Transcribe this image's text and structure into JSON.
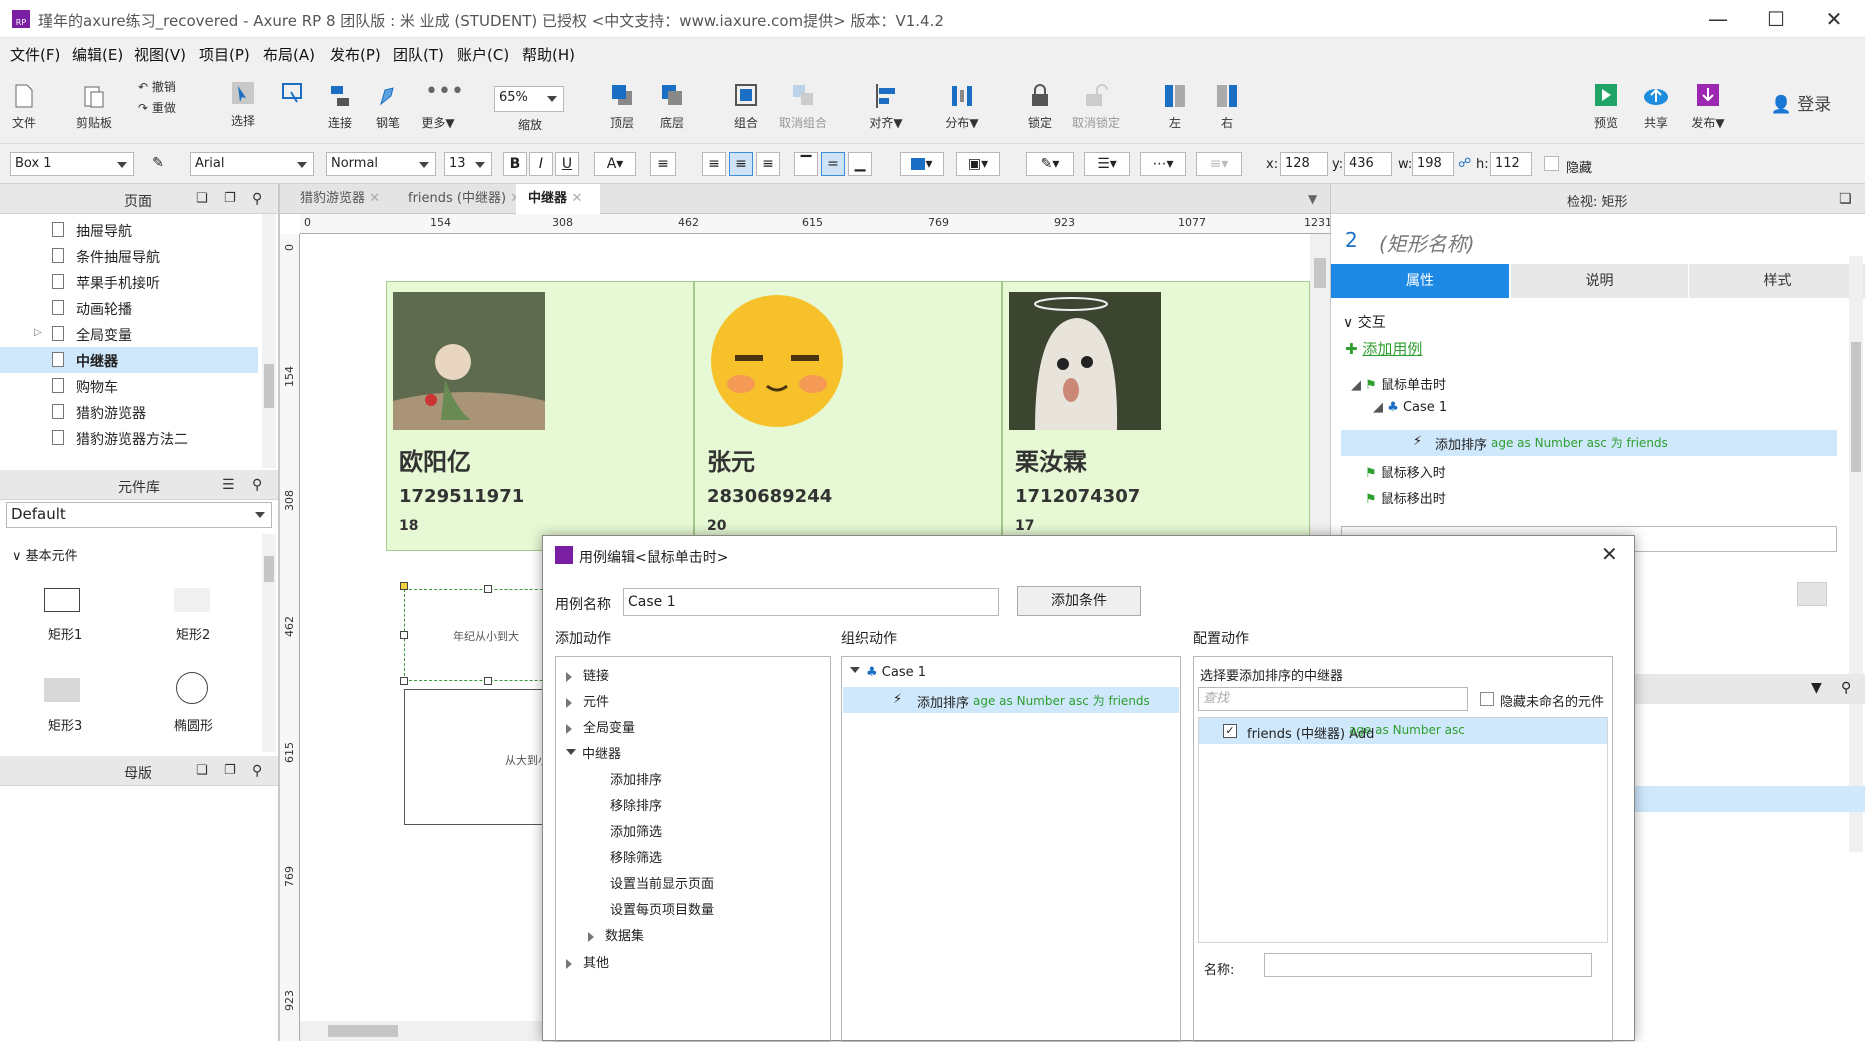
{
  "window": {
    "title": "瑾年的axure练习_recovered - Axure RP 8 团队版 : 米 业成 (STUDENT) 已授权     <中文支持：www.iaxure.com提供> 版本：V1.4.2",
    "logo": "RP"
  },
  "menu": [
    "文件(F)",
    "编辑(E)",
    "视图(V)",
    "项目(P)",
    "布局(A)",
    "发布(P)",
    "团队(T)",
    "账户(C)",
    "帮助(H)"
  ],
  "toolbar": {
    "file": "文件",
    "clipboard": "剪贴板",
    "undo": "撤销",
    "redo": "重做",
    "select": "选择",
    "connect": "连接",
    "pen": "钢笔",
    "more": "更多▼",
    "zoom_value": "65%",
    "zoom": "缩放",
    "top": "顶层",
    "bottom": "底层",
    "group": "组合",
    "ungroup": "取消组合",
    "align": "对齐▼",
    "distribute": "分布▼",
    "lock": "锁定",
    "unlock": "取消锁定",
    "left": "左",
    "right": "右",
    "preview": "预览",
    "share": "共享",
    "publish": "发布▼",
    "login": "登录"
  },
  "format": {
    "element_name": "Box 1",
    "font": "Arial",
    "style": "Normal",
    "size": "13",
    "bold": "B",
    "italic": "I",
    "underline": "U",
    "x_label": "x:",
    "x": "128",
    "y_label": "y:",
    "y": "436",
    "w_label": "w:",
    "w": "198",
    "h_label": "h:",
    "h": "112",
    "hidden": "隐藏"
  },
  "pages_panel": {
    "title": "页面",
    "items": [
      {
        "name": "抽屉导航"
      },
      {
        "name": "条件抽屉导航"
      },
      {
        "name": "苹果手机接听"
      },
      {
        "name": "动画轮播"
      },
      {
        "name": "全局变量"
      },
      {
        "name": "中继器"
      },
      {
        "name": "购物车"
      },
      {
        "name": "猎豹游览器"
      },
      {
        "name": "猎豹游览器方法二"
      }
    ]
  },
  "library_panel": {
    "title": "元件库",
    "selected": "Default",
    "group": "基本元件",
    "widgets": [
      "矩形1",
      "矩形2",
      "矩形3",
      "椭圆形"
    ]
  },
  "masters_panel": {
    "title": "母版"
  },
  "tabs": [
    "猎豹游览器",
    "friends (中继器)",
    "中继器"
  ],
  "ruler": {
    "h": [
      "0",
      "154",
      "308",
      "462",
      "615",
      "769",
      "923",
      "1077",
      "1231"
    ],
    "v": [
      "0",
      "154",
      "308",
      "462",
      "615",
      "769",
      "923"
    ]
  },
  "cards": [
    {
      "name": "欧阳亿",
      "phone": "1729511971",
      "age": "18"
    },
    {
      "name": "张元",
      "phone": "2830689244",
      "age": "20"
    },
    {
      "name": "栗汝霖",
      "phone": "1712074307",
      "age": "17"
    }
  ],
  "canvas_labels": {
    "box1": "年纪从小到大",
    "box2": "从大到小"
  },
  "inspector": {
    "title": "检视: 矩形",
    "number": "2",
    "shape_name": "(矩形名称)",
    "tabs": [
      "属性",
      "说明",
      "样式"
    ],
    "section": "交互",
    "add_case": "添加用例",
    "events": [
      {
        "label": "鼠标单击时"
      },
      {
        "label": "Case 1"
      },
      {
        "label": "添加排序",
        "detail": "age as Number asc 为 friends"
      },
      {
        "label": "鼠标移入时"
      },
      {
        "label": "鼠标移出时"
      }
    ]
  },
  "dialog": {
    "title": "用例编辑<鼠标单击时>",
    "case_name_label": "用例名称",
    "case_name": "Case 1",
    "add_condition": "添加条件",
    "add_action": "添加动作",
    "organize": "组织动作",
    "configure": "配置动作",
    "actions": [
      {
        "label": "链接"
      },
      {
        "label": "元件"
      },
      {
        "label": "全局变量"
      },
      {
        "label": "中继器"
      },
      {
        "label": "添加排序"
      },
      {
        "label": "移除排序"
      },
      {
        "label": "添加筛选"
      },
      {
        "label": "移除筛选"
      },
      {
        "label": "设置当前显示页面"
      },
      {
        "label": "设置每页项目数量"
      },
      {
        "label": "数据集"
      },
      {
        "label": "其他"
      }
    ],
    "org_case": "Case 1",
    "org_action": "添加排序",
    "org_detail": "age as Number asc 为 friends",
    "config_title": "选择要添加排序的中继器",
    "search_placeholder": "查找",
    "hide_unnamed": "隐藏未命名的元件",
    "repeater_item": "friends (中继器) Add",
    "repeater_detail": "age as Number asc",
    "name_label": "名称:"
  }
}
